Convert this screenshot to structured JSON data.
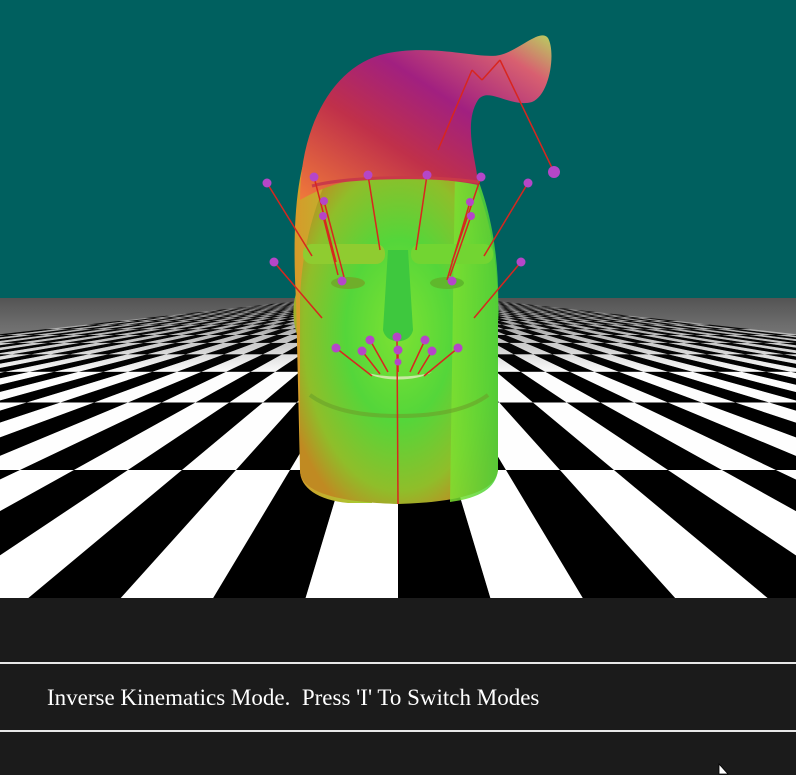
{
  "scene": {
    "sky_color": "#00605f",
    "floor_colors": [
      "#000000",
      "#ffffff"
    ],
    "handle_color": "#b546c8",
    "bone_color": "#d8261e",
    "model": "head-mesh",
    "handle_count": 24
  },
  "status_bar": {
    "message": "Inverse Kinematics Mode.  Press 'I' To Switch Modes",
    "background": "#1b1b1b",
    "text_color": "#ffffff"
  },
  "cursor": {
    "icon": "mouse-pointer-icon"
  }
}
